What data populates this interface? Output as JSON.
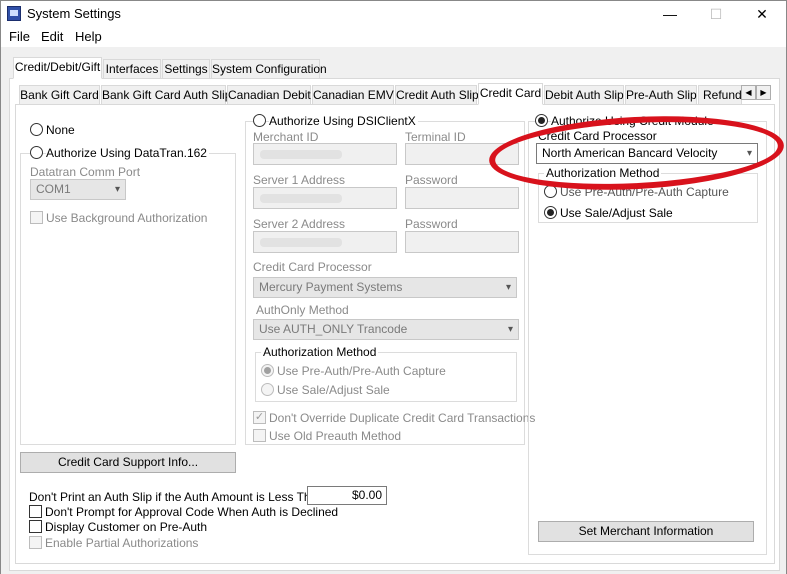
{
  "window": {
    "title": "System Settings",
    "minimize": "—",
    "maximize": "☐",
    "close": "✕"
  },
  "menu": [
    "File",
    "Edit",
    "Help"
  ],
  "top_tabs": [
    "Credit/Debit/Gift",
    "Interfaces",
    "Settings",
    "System Configuration"
  ],
  "sub_tabs": [
    "Bank Gift Card",
    "Bank Gift Card Auth Slip",
    "Canadian Debit",
    "Canadian EMV",
    "Credit Auth Slip",
    "Credit Card",
    "Debit Auth Slip",
    "Pre-Auth Slip",
    "Refund"
  ],
  "scroll": {
    "left": "◀",
    "right": "▶"
  },
  "left": {
    "none_label": "None",
    "datatran_label": "Authorize Using DataTran.162",
    "comm_port_label": "Datatran Comm Port",
    "comm_port_value": "COM1",
    "background_auth_label": "Use Background Authorization",
    "support_button": "Credit Card Support Info..."
  },
  "dsi": {
    "radio_label": "Authorize Using DSIClientX",
    "merchant_id_label": "Merchant ID",
    "terminal_id_label": "Terminal ID",
    "server1_label": "Server 1 Address",
    "password1_label": "Password",
    "server2_label": "Server 2 Address",
    "password2_label": "Password",
    "processor_label": "Credit Card Processor",
    "processor_value": "Mercury Payment Systems",
    "authonly_label": "AuthOnly Method",
    "authonly_value": "Use AUTH_ONLY Trancode",
    "auth_method_label": "Authorization Method",
    "preauth_label": "Use Pre-Auth/Pre-Auth Capture",
    "sale_label": "Use Sale/Adjust Sale",
    "no_override_label": "Don't Override Duplicate Credit Card Transactions",
    "old_preauth_label": "Use Old Preauth Method"
  },
  "module": {
    "radio_label": "Authorize Using Credit Module",
    "processor_label": "Credit Card Processor",
    "processor_value": "North American Bancard Velocity",
    "auth_method_label": "Authorization Method",
    "preauth_label": "Use Pre-Auth/Pre-Auth Capture",
    "sale_label": "Use Sale/Adjust Sale",
    "merchant_button": "Set Merchant Information"
  },
  "bottom": {
    "no_print_label": "Don't Print an Auth Slip if the Auth Amount is Less Than",
    "no_print_value": "$0.00",
    "no_prompt_label": "Don't Prompt for Approval Code When Auth is Declined",
    "display_customer_label": "Display Customer on Pre-Auth",
    "partial_auth_label": "Enable Partial Authorizations"
  },
  "colors": {
    "annotation": "#d8121c",
    "panel": "#ffffff",
    "chrome": "#f0f0f0"
  },
  "icons": {
    "dropdown": "▾",
    "check": "✓"
  }
}
